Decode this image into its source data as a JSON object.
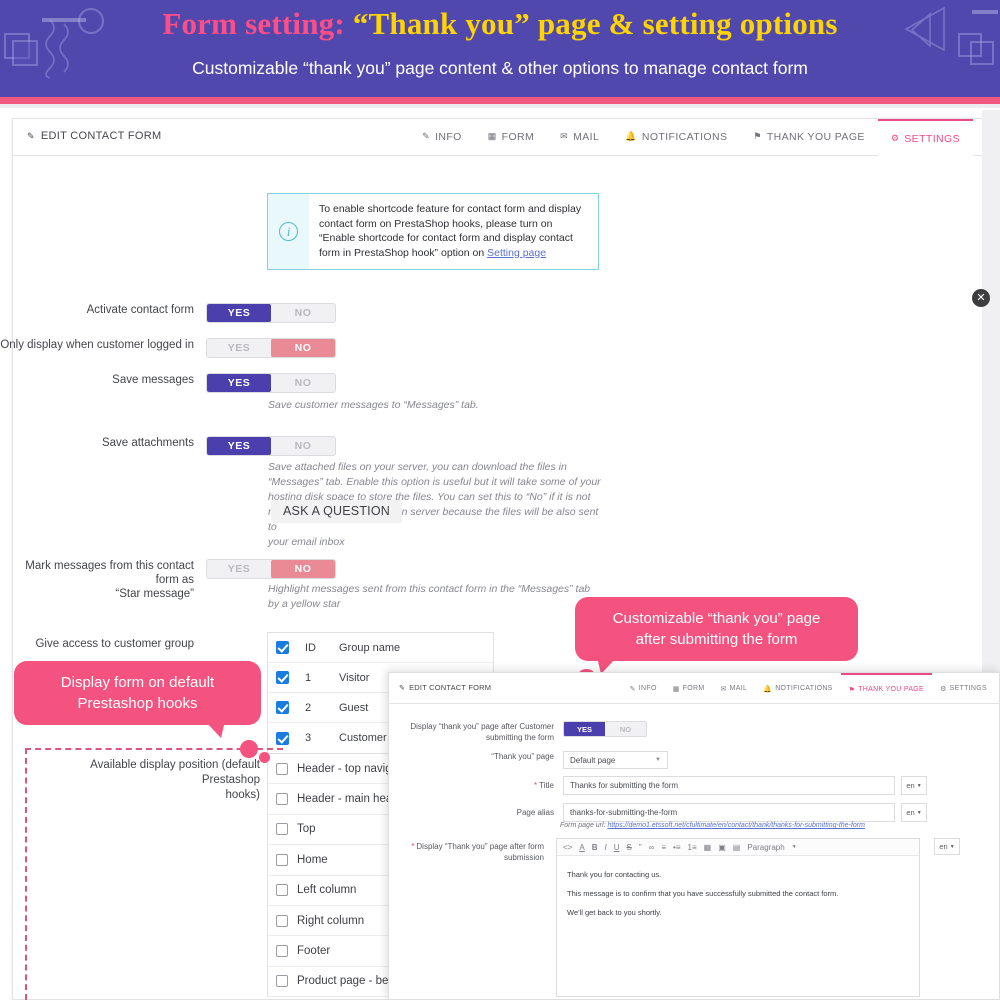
{
  "banner": {
    "title_part1": "Form setting: ",
    "title_part2": "“Thank you” page & setting options",
    "subtitle": "Customizable “thank you” page content & other options to manage contact form",
    "bg_color": "#5048ad",
    "pink": "#ff4d87",
    "gold": "#ffd400"
  },
  "card": {
    "edit_title": "EDIT CONTACT FORM",
    "edit_icon": "edit-pencil-icon",
    "tabs": [
      {
        "label": "INFO",
        "icon": "info-tag-icon",
        "active": false
      },
      {
        "label": "FORM",
        "icon": "form-icon",
        "active": false
      },
      {
        "label": "MAIL",
        "icon": "mail-icon",
        "active": false
      },
      {
        "label": "NOTIFICATIONS",
        "icon": "bell-icon",
        "active": false
      },
      {
        "label": "THANK YOU PAGE",
        "icon": "flag-icon",
        "active": false
      },
      {
        "label": "SETTINGS",
        "icon": "gear-icon",
        "active": true
      }
    ],
    "accent_color": "#ec4a89"
  },
  "infobox": {
    "icon": "info-circle-icon",
    "line1": "To enable shortcode feature for contact form and display",
    "line2": "contact form on PrestaShop hooks, please turn on",
    "line3": "“Enable shortcode for contact form and display contact",
    "line4_pre": "form in PrestaShop hook” option on ",
    "link": "Setting page"
  },
  "settings": {
    "rows": [
      {
        "label": "Activate contact form",
        "value": "YES",
        "yes": "YES",
        "no": "NO",
        "hint": ""
      },
      {
        "label": "Only display when customer logged in",
        "value": "NO",
        "yes": "YES",
        "no": "NO",
        "hint": ""
      },
      {
        "label": "Save messages",
        "value": "YES",
        "yes": "YES",
        "no": "NO",
        "hint": "Save customer messages to “Messages” tab."
      },
      {
        "label": "Save attachments",
        "value": "YES",
        "yes": "YES",
        "no": "NO",
        "hint_l1": "Save attached files on your server, you can download the files in",
        "hint_l2": "“Messages” tab. Enable this option is useful but it will take some of your",
        "hint_l3": "hosting disk space to store the files. You can set this to “No” if it is not",
        "hint_l4": "necessary to store the files on server because the files will be also sent to",
        "hint_l5": "your email inbox"
      },
      {
        "label_l1": "Mark messages from this contact form as",
        "label_l2": "“Star message”",
        "value": "NO",
        "yes": "YES",
        "no": "NO",
        "hint_l1": "Highlight messages sent from this contact form in the “Messages” tab",
        "hint_l2": "by a yellow star"
      }
    ],
    "group_label": "Give access to customer group",
    "group_headers": {
      "id": "ID",
      "name": "Group name"
    },
    "groups": [
      {
        "id": "1",
        "name": "Visitor",
        "checked": true
      },
      {
        "id": "2",
        "name": "Guest",
        "checked": true
      },
      {
        "id": "3",
        "name": "Customer",
        "checked": true
      }
    ],
    "hooks_label_l1": "Available display position (default Prestashop",
    "hooks_label_l2": "hooks)",
    "hooks": [
      {
        "label": "Header - top navigation",
        "checked": false
      },
      {
        "label": "Header - main header",
        "checked": false
      },
      {
        "label": "Top",
        "checked": false
      },
      {
        "label": "Home",
        "checked": false
      },
      {
        "label": "Left column",
        "checked": false
      },
      {
        "label": "Right column",
        "checked": false
      },
      {
        "label": "Footer",
        "checked": false
      },
      {
        "label": "Product page - below",
        "checked": false
      }
    ]
  },
  "ask_widget": {
    "label": "ASK A QUESTION"
  },
  "close_button": {
    "icon": "close-icon",
    "glyph": "✕"
  },
  "callouts": [
    {
      "line1": "Display form on default",
      "line2": "Prestashop hooks",
      "color": "#f4527f"
    },
    {
      "line1": "Customizable “thank you” page",
      "line2": "after submitting the form",
      "color": "#f4527f"
    }
  ],
  "inset": {
    "edit_title": "EDIT CONTACT FORM",
    "tabs": [
      {
        "label": "INFO",
        "icon": "info-tag-icon",
        "active": false
      },
      {
        "label": "FORM",
        "icon": "form-icon",
        "active": false
      },
      {
        "label": "MAIL",
        "icon": "mail-icon",
        "active": false
      },
      {
        "label": "NOTIFICATIONS",
        "icon": "bell-icon",
        "active": false
      },
      {
        "label": "THANK YOU PAGE",
        "icon": "flag-icon",
        "active": true
      },
      {
        "label": "SETTINGS",
        "icon": "gear-icon",
        "active": false
      }
    ],
    "display_label_l1": "Display “thank you” page after Customer",
    "display_label_l2": "submitting the form",
    "display_value": "YES",
    "display_yes": "YES",
    "display_no": "NO",
    "page_label": "“Thank you” page",
    "page_value": "Default page",
    "title_label": "Title",
    "title_value": "Thanks for submitting the form",
    "alias_label": "Page alias",
    "alias_value": "thanks-for-submitting-the-form",
    "url_prefix": "Form page url: ",
    "url_value": "https://demo1.etssoft.net/cfultimate/en/contact/thank/thanks-for-submitting-the-form",
    "editor_label_l1": "Display “Thank you” page after form",
    "editor_label_l2": "submission",
    "lang": "en",
    "toolbar": [
      {
        "glyph": "<>",
        "name": "source-code-icon"
      },
      {
        "glyph": "A",
        "name": "text-color-icon"
      },
      {
        "glyph": "B",
        "name": "bold-icon"
      },
      {
        "glyph": "I",
        "name": "italic-icon"
      },
      {
        "glyph": "U",
        "name": "underline-icon"
      },
      {
        "glyph": "S",
        "name": "strikethrough-icon"
      },
      {
        "glyph": "\"",
        "name": "blockquote-icon"
      },
      {
        "glyph": "∞",
        "name": "link-icon"
      },
      {
        "glyph": "≡",
        "name": "align-icon"
      },
      {
        "glyph": "•≡",
        "name": "bullet-list-icon"
      },
      {
        "glyph": "1≡",
        "name": "numbered-list-icon"
      },
      {
        "glyph": "▦",
        "name": "table-icon"
      },
      {
        "glyph": "▣",
        "name": "image-icon"
      },
      {
        "glyph": "▤",
        "name": "media-icon"
      },
      {
        "glyph": "Paragraph",
        "name": "paragraph-format-select"
      }
    ],
    "editor_content": [
      "Thank you for contacting us.",
      "This message is to confirm that you have successfully submitted the contact form.",
      "We'll get back to you shortly."
    ]
  }
}
